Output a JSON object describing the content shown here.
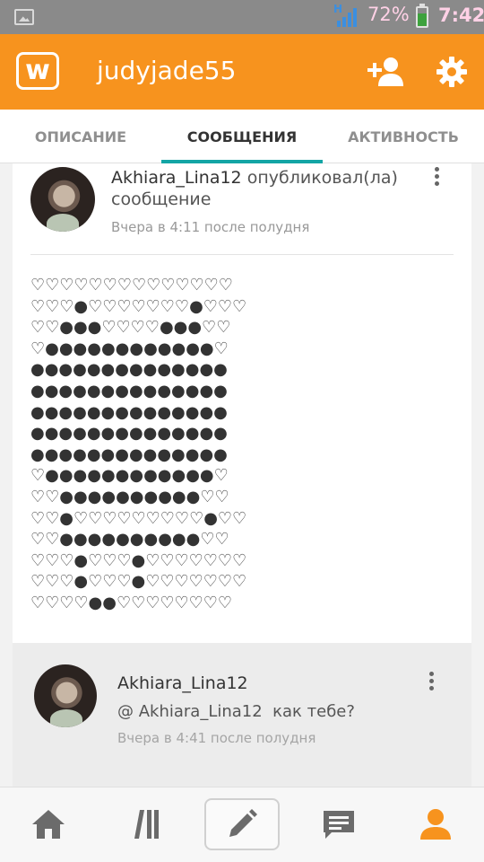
{
  "status_bar": {
    "network_type": "H",
    "battery_percent": "72%",
    "battery_level": 0.72,
    "time": "7:42",
    "icons": [
      "gallery-icon",
      "signal-icon",
      "battery-icon"
    ]
  },
  "app_bar": {
    "logo_letter": "w",
    "username": "judyjade55",
    "icons": [
      "add-user-icon",
      "gear-icon"
    ],
    "accent_color": "#f7931e"
  },
  "tabs": {
    "items": [
      {
        "label": "ОПИСАНИЕ"
      },
      {
        "label": "СООБЩЕНИЯ"
      },
      {
        "label": "АКТИВНОСТЬ"
      }
    ],
    "active_index": 1,
    "indicator_color": "#13a5a5"
  },
  "post": {
    "author": "Akhiara_Lina12",
    "action": "опубликовал(ла) сообщение",
    "timestamp": "Вчера в 4:11 после полудня",
    "body_lines": [
      "♡♡♡♡♡♡♡♡♡♡♡♡♡♡",
      "♡♡♡●♡♡♡♡♡♡♡●♡♡♡",
      "♡♡●●●♡♡♡♡●●●♡♡",
      "♡●●●●●●●●●●●●♡",
      "●●●●●●●●●●●●●●",
      "●●●●●●●●●●●●●●",
      "●●●●●●●●●●●●●●",
      "●●●●●●●●●●●●●●",
      "●●●●●●●●●●●●●●",
      "♡●●●●●●●●●●●●♡",
      "♡♡●●●●●●●●●●♡♡",
      "♡♡●♡♡♡♡♡♡♡♡♡●♡♡",
      "♡♡●●●●●●●●●●♡♡",
      "♡♡♡●♡♡♡●♡♡♡♡♡♡♡",
      "♡♡♡●♡♡♡●♡♡♡♡♡♡♡",
      "♡♡♡♡●●♡♡♡♡♡♡♡♡"
    ]
  },
  "comment": {
    "author": "Akhiara_Lina12",
    "text": "@ Akhiara_Lina12  как тебе?",
    "timestamp": "Вчера в 4:41 после полудня"
  },
  "bottom_nav": {
    "items": [
      {
        "icon": "home-icon"
      },
      {
        "icon": "library-icon"
      },
      {
        "icon": "pencil-icon"
      },
      {
        "icon": "message-icon"
      },
      {
        "icon": "profile-icon"
      }
    ],
    "active_index": 4,
    "active_color": "#f7931e",
    "inactive_color": "#6b6b6b"
  }
}
